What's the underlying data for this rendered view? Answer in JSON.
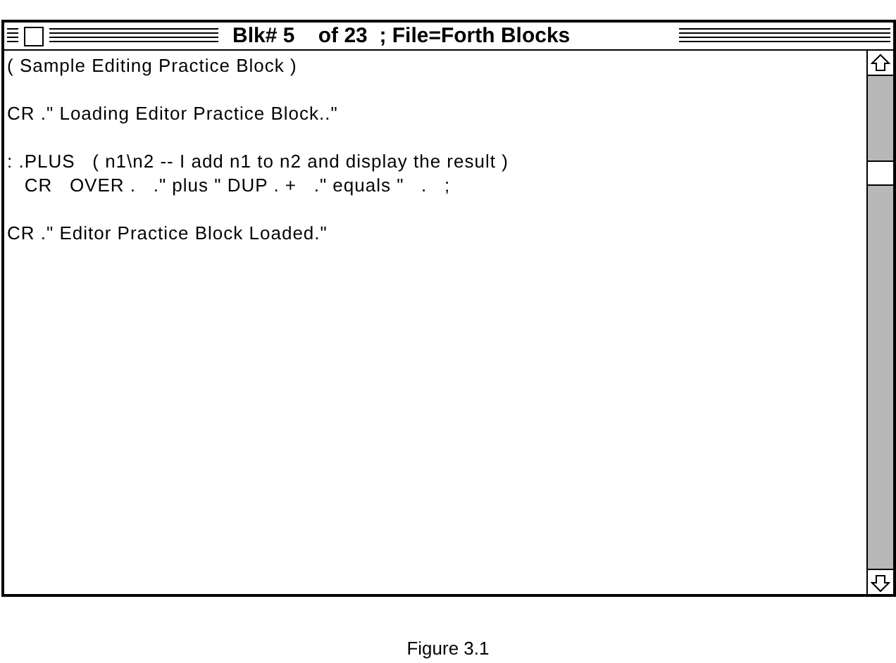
{
  "window": {
    "title": "Blk# 5    of 23  ; File=Forth Blocks"
  },
  "editor": {
    "paragraphs": [
      [
        "( Sample Editing Practice Block )"
      ],
      [
        "CR .\" Loading Editor Practice Block..\""
      ],
      [
        ": .PLUS   ( n1\\n2 -- I add n1 to n2 and display the result )",
        "   CR   OVER .   .\" plus \" DUP . +   .\" equals \"   .   ;"
      ],
      [
        "CR .\" Editor Practice Block Loaded.\""
      ]
    ]
  },
  "caption": "Figure 3.1"
}
